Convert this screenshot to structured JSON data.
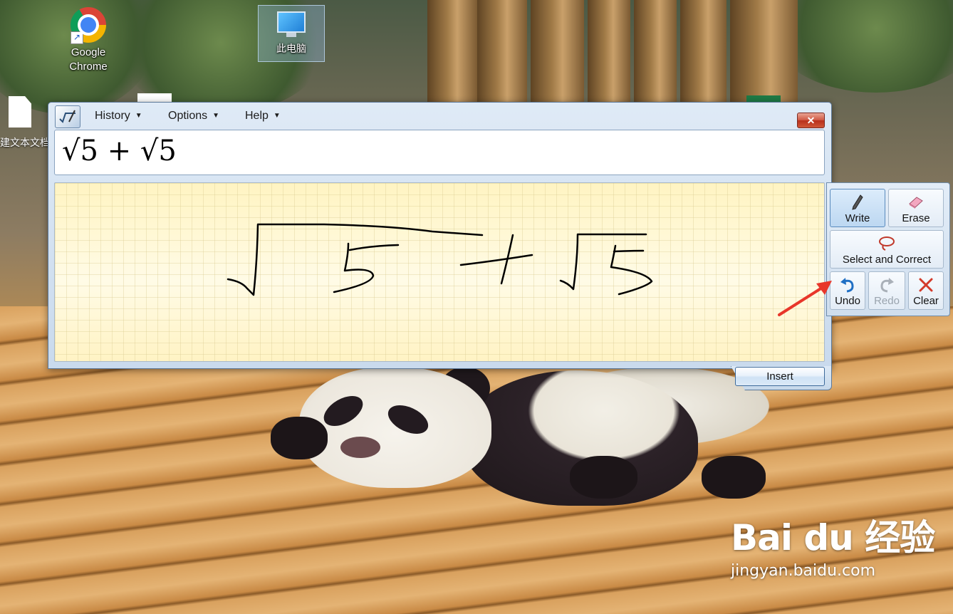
{
  "desktop": {
    "icons": {
      "chrome": {
        "label_line1": "Google",
        "label_line2": "Chrome"
      },
      "this_pc": {
        "label": "此电脑"
      },
      "text_doc": {
        "label": "建文本文档"
      }
    }
  },
  "window": {
    "menus": [
      "History",
      "Options",
      "Help"
    ],
    "close_label": "✕",
    "preview_expression": "√5 + √5",
    "insert_label": "Insert"
  },
  "tools": {
    "write": "Write",
    "erase": "Erase",
    "select_and_correct": "Select and Correct",
    "undo": "Undo",
    "redo": "Redo",
    "clear": "Clear"
  },
  "watermark": {
    "logo": "Bai du 经验",
    "url": "jingyan.baidu.com"
  },
  "colors": {
    "accent": "#5a8bbd",
    "close": "#c8402a",
    "annotation": "#e8362a",
    "writing_bg": "#fff6c8"
  }
}
